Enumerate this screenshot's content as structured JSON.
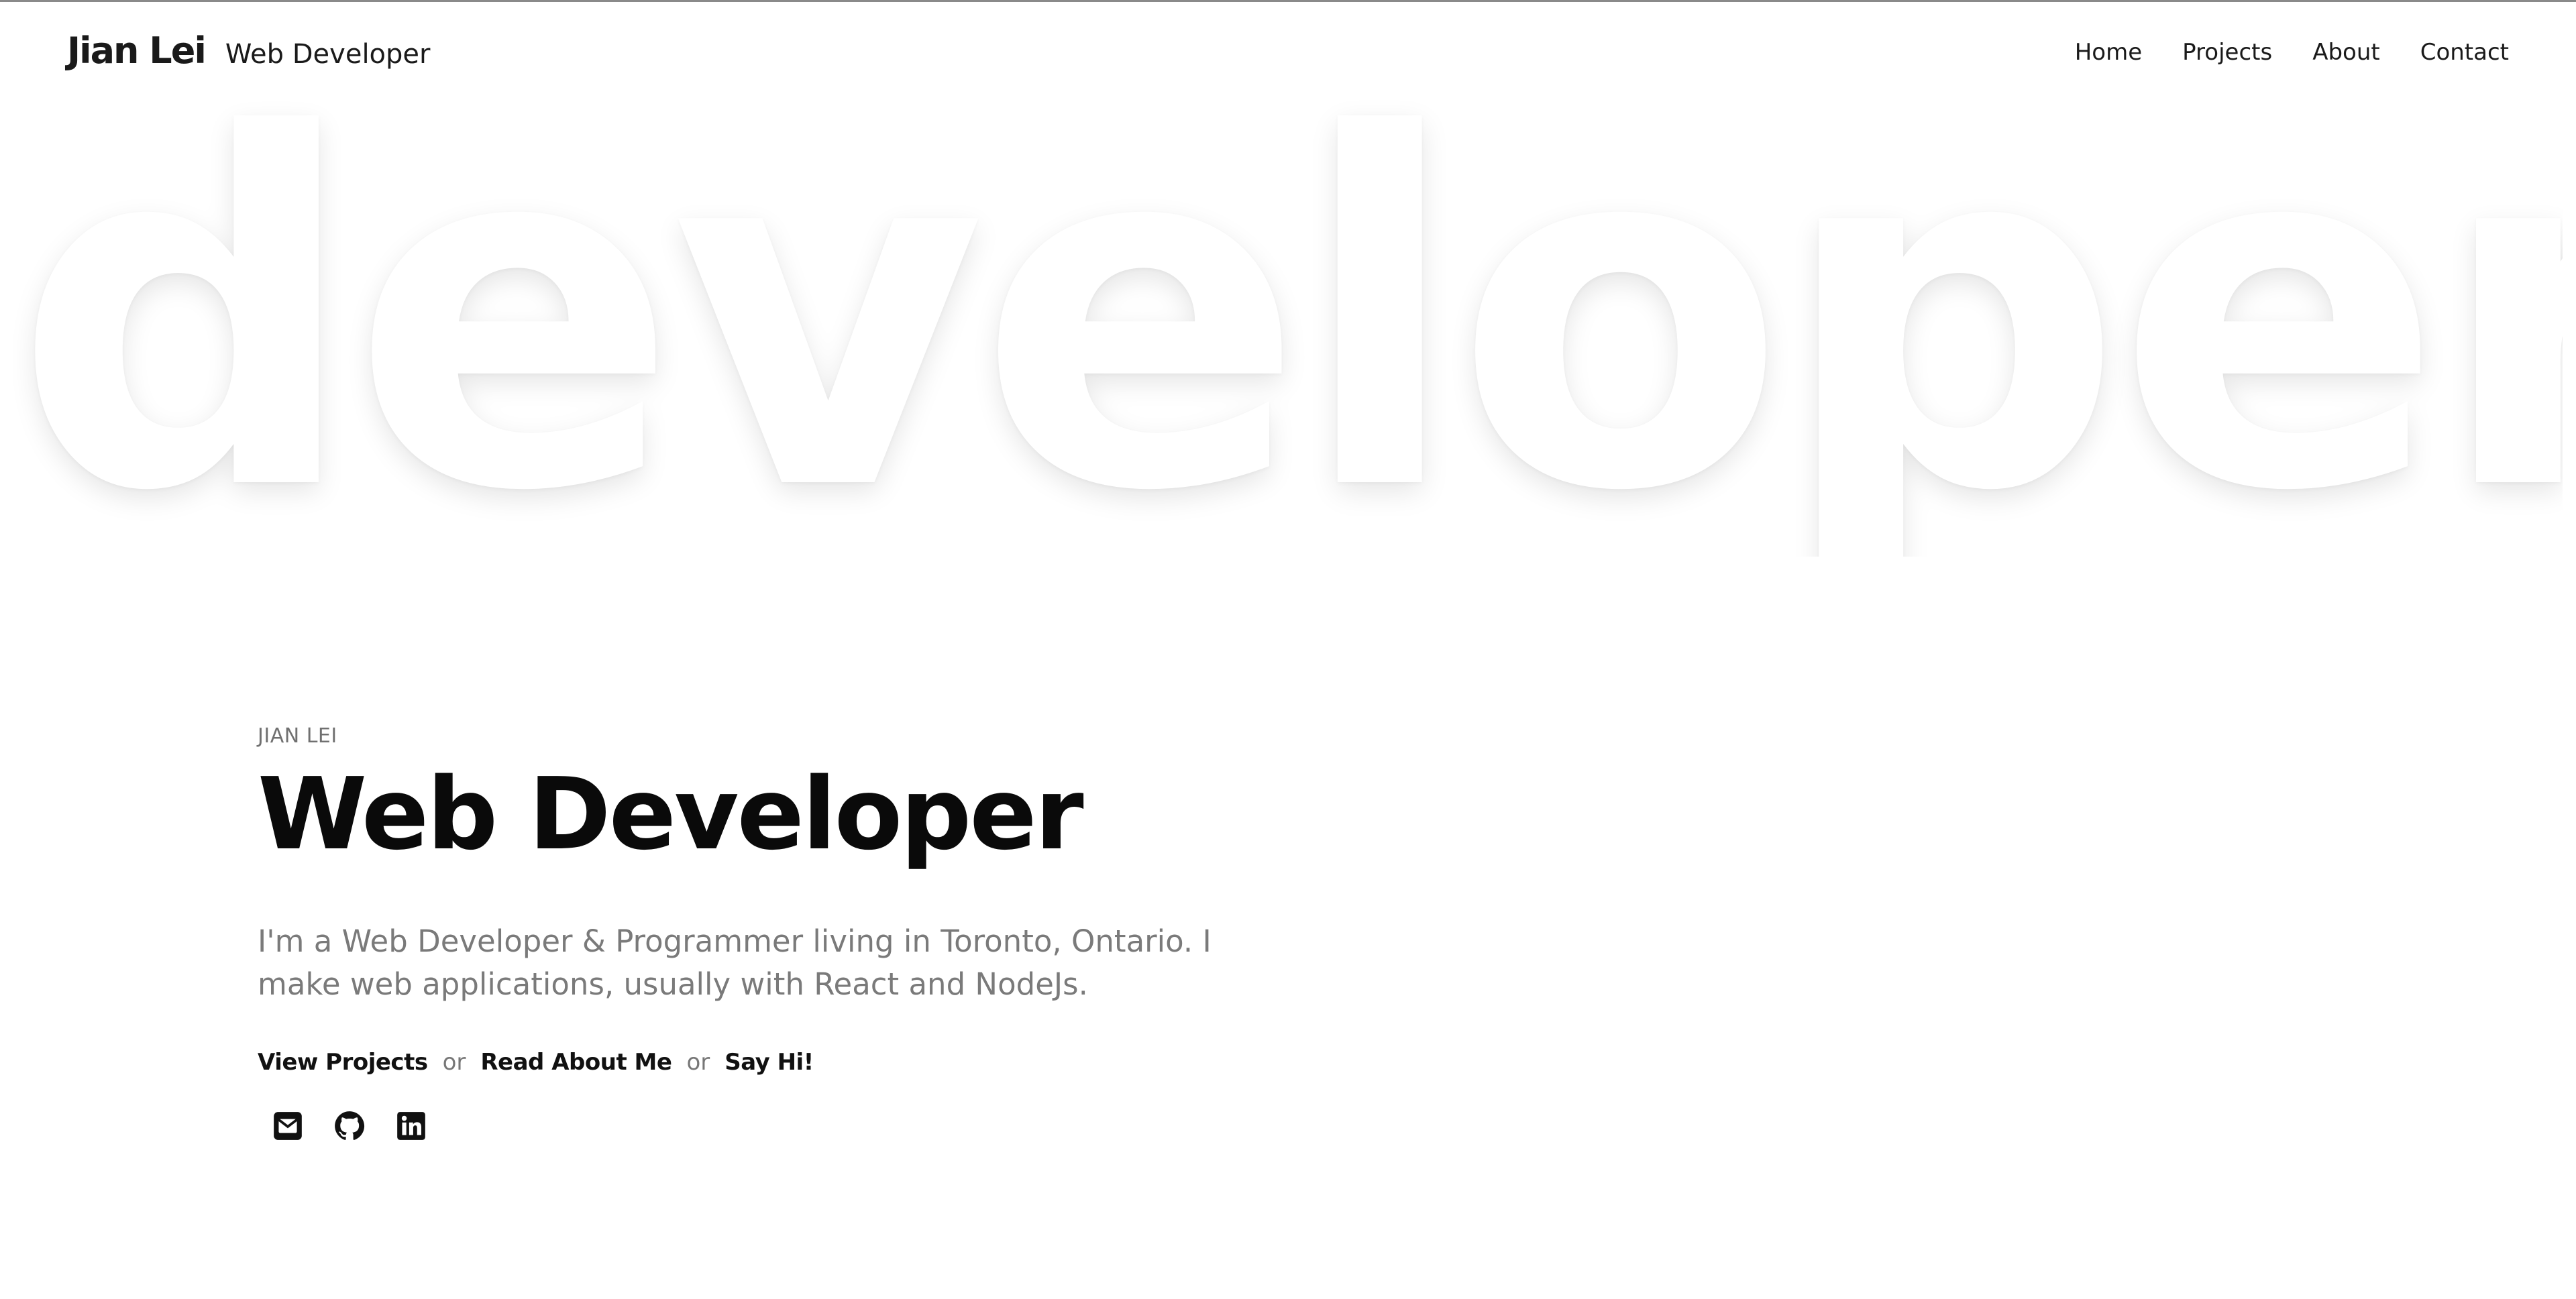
{
  "header": {
    "brand_name": "Jian Lei",
    "brand_role": "Web Developer",
    "nav": [
      {
        "label": "Home"
      },
      {
        "label": "Projects"
      },
      {
        "label": "About"
      },
      {
        "label": "Contact"
      }
    ]
  },
  "background_word": "developer.",
  "hero": {
    "eyebrow": "JIAN LEI",
    "headline": "Web Developer",
    "intro": "I'm a Web Developer & Programmer living in Toronto, Ontario. I make web applications, usually with React and NodeJs.",
    "ctas": [
      {
        "label": "View Projects"
      },
      {
        "label": "Read About Me"
      },
      {
        "label": "Say Hi!"
      }
    ],
    "separator": "or"
  },
  "social": [
    {
      "icon": "email-icon"
    },
    {
      "icon": "github-icon"
    },
    {
      "icon": "linkedin-icon"
    }
  ],
  "colors": {
    "text": "#111111",
    "muted": "#7a7a7a",
    "background": "#ffffff"
  }
}
